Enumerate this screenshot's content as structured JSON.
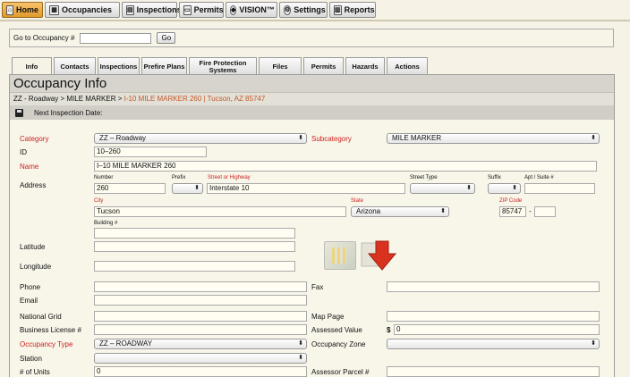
{
  "nav": {
    "home": "Home",
    "occupancies": "Occupancies",
    "inspections": "Inspections",
    "permits": "Permits",
    "vision": "VISION™",
    "settings": "Settings",
    "reports": "Reports"
  },
  "goto": {
    "label": "Go to Occupancy #",
    "value": "",
    "button": "Go"
  },
  "tabs": [
    "Info",
    "Contacts",
    "Inspections",
    "Prefire Plans",
    "Fire Protection Systems",
    "Files",
    "Permits",
    "Hazards",
    "Actions"
  ],
  "header": {
    "title": "Occupancy Info",
    "crumb_plain": "ZZ - Roadway > MILE MARKER > ",
    "crumb_link": "I-10 MILE MARKER 260 | Tucson, AZ 85747",
    "next_inspection": "Next Inspection Date:"
  },
  "form": {
    "category_label": "Category",
    "category_value": "ZZ – Roadway",
    "subcategory_label": "Subcategory",
    "subcategory_value": "MILE MARKER",
    "id_label": "ID",
    "id_value": "10–260",
    "name_label": "Name",
    "name_value": "I–10 MILE MARKER 260",
    "address_label": "Address",
    "number_label": "Number",
    "number_value": "260",
    "prefix_label": "Prefix",
    "prefix_value": "",
    "street_label": "Street or Highway",
    "street_value": "Interstate 10",
    "street_type_label": "Street Type",
    "street_type_value": "",
    "suffix_label": "Suffix",
    "suffix_value": "",
    "apt_label": "Apt / Suite #",
    "apt_value": "",
    "city_label": "City",
    "city_value": "Tucson",
    "state_label": "State",
    "state_value": "Arizona",
    "zip_label": "ZIP Code",
    "zip_value": "85747",
    "zip_dash": "-",
    "zip_ext_value": "",
    "building_label": "Building #",
    "building_value": "",
    "latitude_label": "Latitude",
    "latitude_value": "",
    "longitude_label": "Longitude",
    "longitude_value": "",
    "phone_label": "Phone",
    "phone_value": "",
    "fax_label": "Fax",
    "fax_value": "",
    "email_label": "Email",
    "email_value": "",
    "national_grid_label": "National Grid",
    "national_grid_value": "",
    "map_page_label": "Map Page",
    "map_page_value": "",
    "business_license_label": "Business License #",
    "business_license_value": "",
    "assessed_value_label": "Assessed Value",
    "currency": "$",
    "assessed_value_value": "0",
    "occupancy_type_label": "Occupancy Type",
    "occupancy_type_value": "ZZ – ROADWAY",
    "occupancy_zone_label": "Occupancy Zone",
    "occupancy_zone_value": "",
    "station_label": "Station",
    "station_value": "",
    "units_label": "# of Units",
    "units_value": "0",
    "parcel_label": "Assessor Parcel #",
    "parcel_value": ""
  },
  "icons": {
    "map": "map-icon",
    "arrow": "down-arrow-icon"
  },
  "colors": {
    "required": "#cc2222",
    "link": "#c45a2a",
    "home_tab": "#e09a2a"
  }
}
